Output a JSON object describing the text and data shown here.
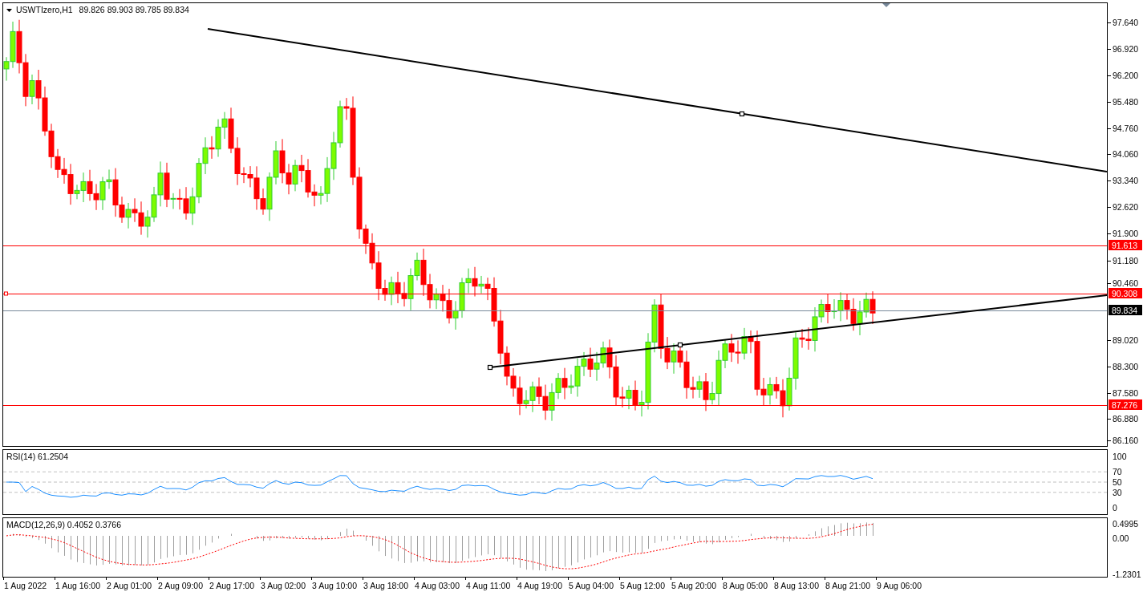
{
  "chart_header": {
    "symbol": "USWTIzero,H1",
    "ohlc": "89.826 89.903 89.785 89.834"
  },
  "price_axis": [
    "97.640",
    "96.920",
    "96.200",
    "95.480",
    "94.760",
    "94.060",
    "93.340",
    "92.620",
    "91.900",
    "91.180",
    "90.460",
    "89.020",
    "88.300",
    "87.580",
    "86.880",
    "86.160"
  ],
  "price_lines": [
    {
      "label": "91.613",
      "kind": "level"
    },
    {
      "label": "90.308",
      "kind": "level"
    },
    {
      "label": "89.834",
      "kind": "bid"
    },
    {
      "label": "87.276",
      "kind": "level"
    }
  ],
  "rsi": {
    "title": "RSI(14) 61.2504",
    "axis": [
      "100",
      "70",
      "50",
      "30",
      "0"
    ]
  },
  "macd": {
    "title": "MACD(12,26,9) 0.4052 0.3766",
    "axis": [
      "0.4995",
      "0.00",
      "-1.2301"
    ]
  },
  "time_axis": [
    "1 Aug 2022",
    "1 Aug 16:00",
    "2 Aug 01:00",
    "2 Aug 09:00",
    "2 Aug 17:00",
    "3 Aug 02:00",
    "3 Aug 10:00",
    "3 Aug 18:00",
    "4 Aug 03:00",
    "4 Aug 11:00",
    "4 Aug 19:00",
    "5 Aug 04:00",
    "5 Aug 12:00",
    "5 Aug 20:00",
    "8 Aug 05:00",
    "8 Aug 13:00",
    "8 Aug 21:00",
    "9 Aug 06:00"
  ]
}
